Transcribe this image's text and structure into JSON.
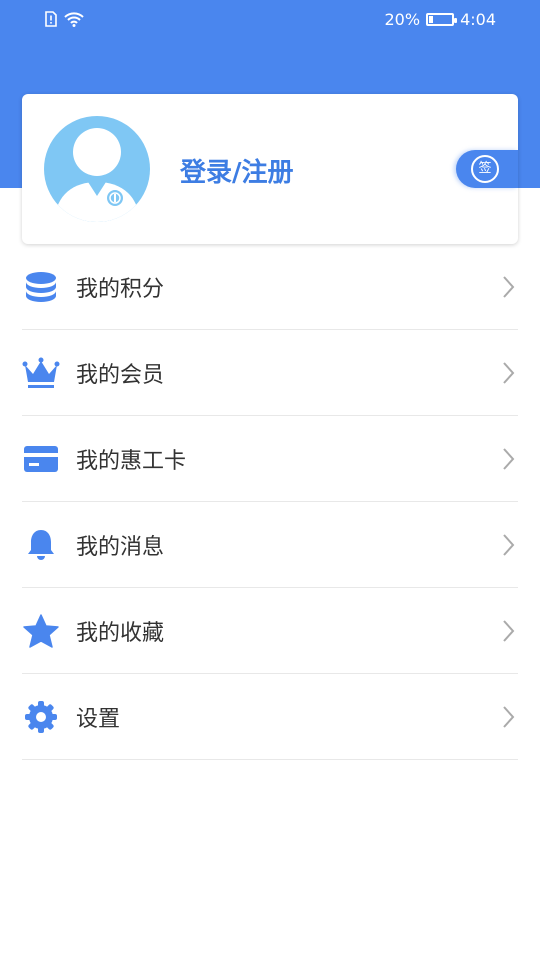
{
  "status_bar": {
    "battery_percent": "20%",
    "time": "4:04",
    "battery_level": 0.2
  },
  "profile": {
    "login_label": "登录/注册",
    "sign_label": "签"
  },
  "colors": {
    "primary": "#4a86ee",
    "avatar_bg": "#7fc7f4",
    "text": "#333333"
  },
  "menu": {
    "items": [
      {
        "label": "我的积分",
        "icon": "coins-stack-icon"
      },
      {
        "label": "我的会员",
        "icon": "crown-icon"
      },
      {
        "label": "我的惠工卡",
        "icon": "card-icon"
      },
      {
        "label": "我的消息",
        "icon": "bell-icon"
      },
      {
        "label": "我的收藏",
        "icon": "star-icon"
      },
      {
        "label": "设置",
        "icon": "gear-icon"
      }
    ]
  }
}
